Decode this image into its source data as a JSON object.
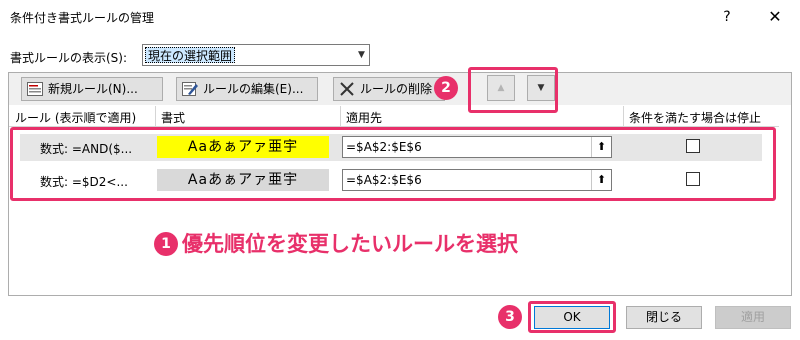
{
  "window": {
    "title": "条件付き書式ルールの管理",
    "help_glyph": "?",
    "close_glyph": "✕"
  },
  "scope": {
    "label": "書式ルールの表示(S):",
    "selected": "現在の選択範囲"
  },
  "toolbar": {
    "new_label": "新規ルール(N)...",
    "edit_label": "ルールの編集(E)...",
    "delete_label": "ルールの削除",
    "up_glyph": "▲",
    "down_glyph": "▼"
  },
  "columns": {
    "rule": "ルール (表示順で適用)",
    "format": "書式",
    "applies_to": "適用先",
    "stop_if_true": "条件を満たす場合は停止"
  },
  "rules": [
    {
      "rule": "数式: =AND($...",
      "preview": "Aaあぁアァ亜宇",
      "applies_to": "=$A$2:$E$6",
      "stop_if_true": false,
      "preview_color": "#ffff00",
      "selected": true
    },
    {
      "rule": "数式: =$D2<...",
      "preview": "Aaあぁアァ亜宇",
      "applies_to": "=$A$2:$E$6",
      "stop_if_true": false,
      "preview_color": "#d9d9d9",
      "selected": false
    }
  ],
  "annotation": {
    "step1_num": "1",
    "step1_text": "優先順位を変更したいルールを選択",
    "step2_num": "2",
    "step3_num": "3",
    "color": "#e8306a"
  },
  "buttons": {
    "ok": "OK",
    "close": "閉じる",
    "apply": "適用"
  }
}
